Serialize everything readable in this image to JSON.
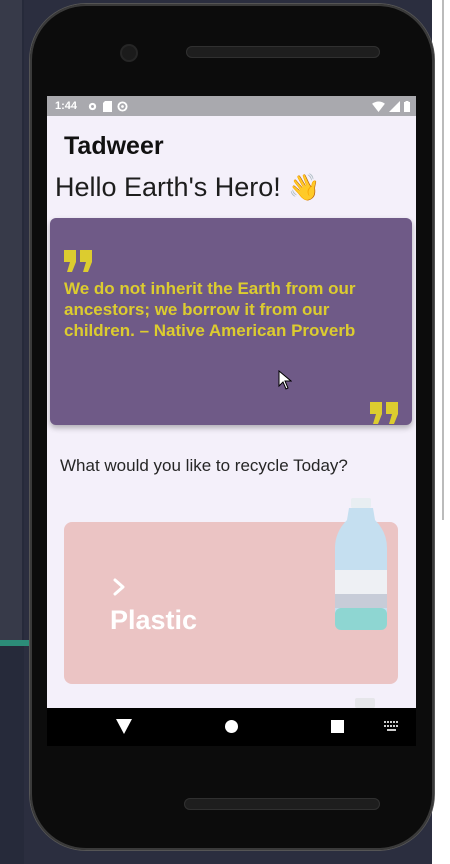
{
  "status_bar": {
    "time": "1:44",
    "left_icons": [
      "gear-icon",
      "sim-card-icon",
      "sync-icon"
    ],
    "right_icons": [
      "wifi-icon",
      "signal-icon",
      "battery-icon"
    ]
  },
  "app": {
    "title": "Tadweer"
  },
  "greeting": {
    "text": "Hello Earth's Hero!",
    "emoji": "👋"
  },
  "quote_card": {
    "open_mark": "❞",
    "text": "We do not inherit the Earth from our ancestors; we borrow it from our children. – Native American Proverb",
    "close_mark": "❞",
    "background": "#6f5a87",
    "text_color": "#dccc2f"
  },
  "prompt": {
    "text": "What would you like to recycle Today?"
  },
  "categories": [
    {
      "label": "Plastic",
      "icon": "chevron-right-icon",
      "image": "plastic-bottle",
      "background": "#ebc4c4"
    }
  ],
  "nav_bar": {
    "buttons": [
      "back-icon",
      "home-icon",
      "recents-icon",
      "keyboard-icon"
    ]
  }
}
